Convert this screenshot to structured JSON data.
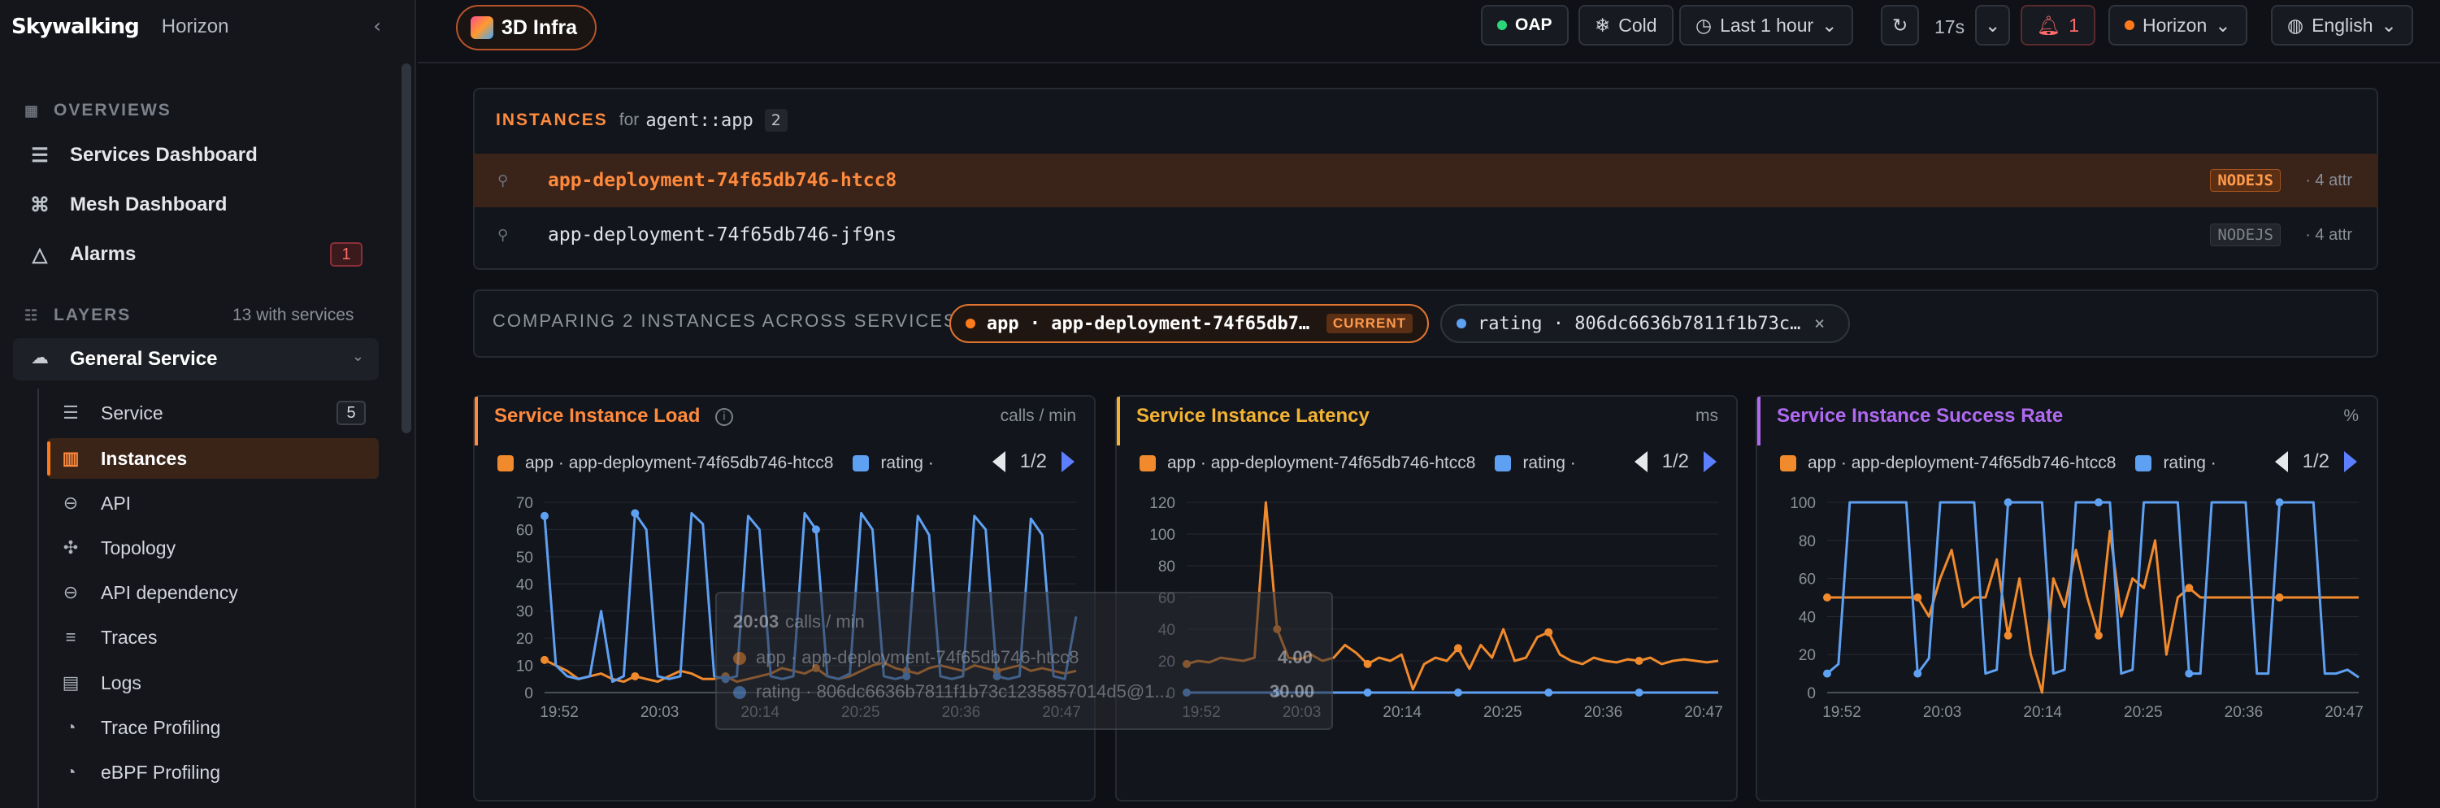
{
  "sidebar": {
    "logo": "Skywalking",
    "product": "Horizon",
    "overviews_heading": "OVERVIEWS",
    "overviews": [
      {
        "label": "Services Dashboard"
      },
      {
        "label": "Mesh Dashboard"
      },
      {
        "label": "Alarms",
        "badge": "1"
      }
    ],
    "layers_heading": "LAYERS",
    "layers_count": "13 with services",
    "group": "General Service",
    "subitems": [
      {
        "label": "Service",
        "badge": "5"
      },
      {
        "label": "Instances",
        "active": true
      },
      {
        "label": "API"
      },
      {
        "label": "Topology"
      },
      {
        "label": "API dependency"
      },
      {
        "label": "Traces"
      },
      {
        "label": "Logs"
      },
      {
        "label": "Trace Profiling"
      },
      {
        "label": "eBPF Profiling"
      }
    ]
  },
  "topbar": {
    "layer": "3D Infra",
    "oap": "OAP",
    "cold": "Cold",
    "time_range": "Last 1 hour",
    "refresh": "17s",
    "alerts": "1",
    "theme": "Horizon",
    "language": "English"
  },
  "instances": {
    "heading": "INSTANCES",
    "for_label": "for",
    "service": "agent::app",
    "count": "2",
    "rows": [
      {
        "name": "app-deployment-74f65db746-htcc8",
        "tag": "NODEJS",
        "attrs": "· 4 attr",
        "selected": true
      },
      {
        "name": "app-deployment-74f65db746-jf9ns",
        "tag": "NODEJS",
        "attrs": "· 4 attr",
        "selected": false
      }
    ]
  },
  "compare": {
    "label": "COMPARING 2 INSTANCES ACROSS SERVICES",
    "current": {
      "text": "app · app-deployment-74f65db7…",
      "badge": "CURRENT"
    },
    "other": {
      "text": "rating · 806dc6636b7811f1b73c…",
      "close": "×"
    }
  },
  "colors": {
    "accent": "#ff7a1a",
    "series_app": "#f08a2c",
    "series_rating": "#5ea0f2",
    "load": "#ff8a3d",
    "latency": "#f2b233",
    "success": "#b06af2"
  },
  "cards": [
    {
      "title": "Service Instance Load",
      "unit": "calls / min",
      "legend_app": "app · app-deployment-74f65db746-htcc8",
      "legend_rating": "rating ·",
      "page": "1/2"
    },
    {
      "title": "Service Instance Latency",
      "unit": "ms",
      "legend_app": "app · app-deployment-74f65db746-htcc8",
      "legend_rating": "rating ·",
      "page": "1/2"
    },
    {
      "title": "Service Instance Success Rate",
      "unit": "%",
      "legend_app": "app · app-deployment-74f65db746-htcc8",
      "legend_rating": "rating ·",
      "page": "1/2"
    }
  ],
  "tooltip": {
    "time": "20:03",
    "unit": "calls / min",
    "app": "app · app-deployment-74f65db746-htcc8",
    "app_val": "4.00",
    "rating": "rating · 806dc6636b7811f1b73c1235857014d5@1...",
    "rating_val": "30.00"
  },
  "chart_data": [
    {
      "type": "line",
      "title": "Service Instance Load",
      "x": [
        "19:52",
        "20:03",
        "20:14",
        "20:25",
        "20:36",
        "20:47"
      ],
      "ylim": [
        0,
        70
      ],
      "yticks": [
        0,
        10,
        20,
        30,
        40,
        50,
        60,
        70
      ],
      "series": [
        {
          "name": "app · app-deployment-74f65db746-htcc8",
          "values": [
            12,
            10,
            8,
            5,
            6,
            7,
            5,
            4,
            6,
            5,
            4,
            6,
            8,
            7,
            5,
            5,
            6,
            4,
            5,
            6,
            7,
            9,
            8,
            7,
            9,
            6,
            5,
            6,
            8,
            10,
            11,
            9,
            8,
            7,
            9,
            10,
            9,
            8,
            10,
            9,
            8,
            9,
            10,
            8,
            9,
            8,
            7,
            8
          ]
        },
        {
          "name": "rating",
          "values": [
            65,
            10,
            6,
            5,
            6,
            30,
            4,
            6,
            66,
            60,
            6,
            5,
            6,
            66,
            62,
            6,
            5,
            6,
            65,
            60,
            6,
            5,
            6,
            66,
            60,
            6,
            5,
            7,
            66,
            60,
            6,
            5,
            6,
            65,
            58,
            6,
            5,
            6,
            65,
            60,
            6,
            5,
            6,
            64,
            58,
            6,
            5,
            28
          ]
        }
      ]
    },
    {
      "type": "line",
      "title": "Service Instance Latency",
      "x": [
        "19:52",
        "20:03",
        "20:14",
        "20:25",
        "20:36",
        "20:47"
      ],
      "ylim": [
        0,
        120
      ],
      "yticks": [
        0,
        20,
        40,
        60,
        80,
        100,
        120
      ],
      "series": [
        {
          "name": "app · app-deployment-74f65db746-htcc8",
          "values": [
            18,
            20,
            19,
            22,
            21,
            20,
            22,
            120,
            40,
            22,
            21,
            24,
            20,
            22,
            30,
            25,
            18,
            22,
            20,
            24,
            2,
            18,
            22,
            20,
            28,
            15,
            30,
            22,
            40,
            20,
            22,
            35,
            38,
            24,
            20,
            18,
            22,
            20,
            19,
            21,
            20,
            22,
            18,
            20,
            21,
            20,
            19,
            20
          ]
        },
        {
          "name": "rating",
          "values": [
            0,
            0,
            0,
            0,
            0,
            0,
            0,
            0,
            0,
            0,
            0,
            0,
            0,
            0,
            0,
            0,
            0,
            0,
            0,
            0,
            0,
            0,
            0,
            0,
            0,
            0,
            0,
            0,
            0,
            0,
            0,
            0,
            0,
            0,
            0,
            0,
            0,
            0,
            0,
            0,
            0,
            0,
            0,
            0,
            0,
            0,
            0,
            0
          ]
        }
      ]
    },
    {
      "type": "line",
      "title": "Service Instance Success Rate",
      "x": [
        "19:52",
        "20:03",
        "20:14",
        "20:25",
        "20:36",
        "20:47"
      ],
      "ylim": [
        0,
        100
      ],
      "yticks": [
        0,
        20,
        40,
        60,
        80,
        100
      ],
      "series": [
        {
          "name": "app · app-deployment-74f65db746-htcc8",
          "values": [
            50,
            50,
            50,
            50,
            50,
            50,
            50,
            50,
            50,
            40,
            60,
            75,
            45,
            50,
            50,
            70,
            30,
            60,
            20,
            0,
            60,
            45,
            75,
            50,
            30,
            85,
            40,
            60,
            55,
            80,
            20,
            50,
            55,
            50,
            50,
            50,
            50,
            50,
            50,
            50,
            50,
            50,
            50,
            50,
            50,
            50,
            50,
            50
          ]
        },
        {
          "name": "rating",
          "values": [
            10,
            15,
            100,
            100,
            100,
            100,
            100,
            100,
            10,
            18,
            100,
            100,
            100,
            100,
            10,
            12,
            100,
            100,
            100,
            100,
            10,
            12,
            100,
            100,
            100,
            100,
            10,
            12,
            100,
            100,
            100,
            100,
            10,
            10,
            100,
            100,
            100,
            100,
            10,
            10,
            100,
            100,
            100,
            100,
            10,
            10,
            12,
            8
          ]
        }
      ]
    }
  ]
}
